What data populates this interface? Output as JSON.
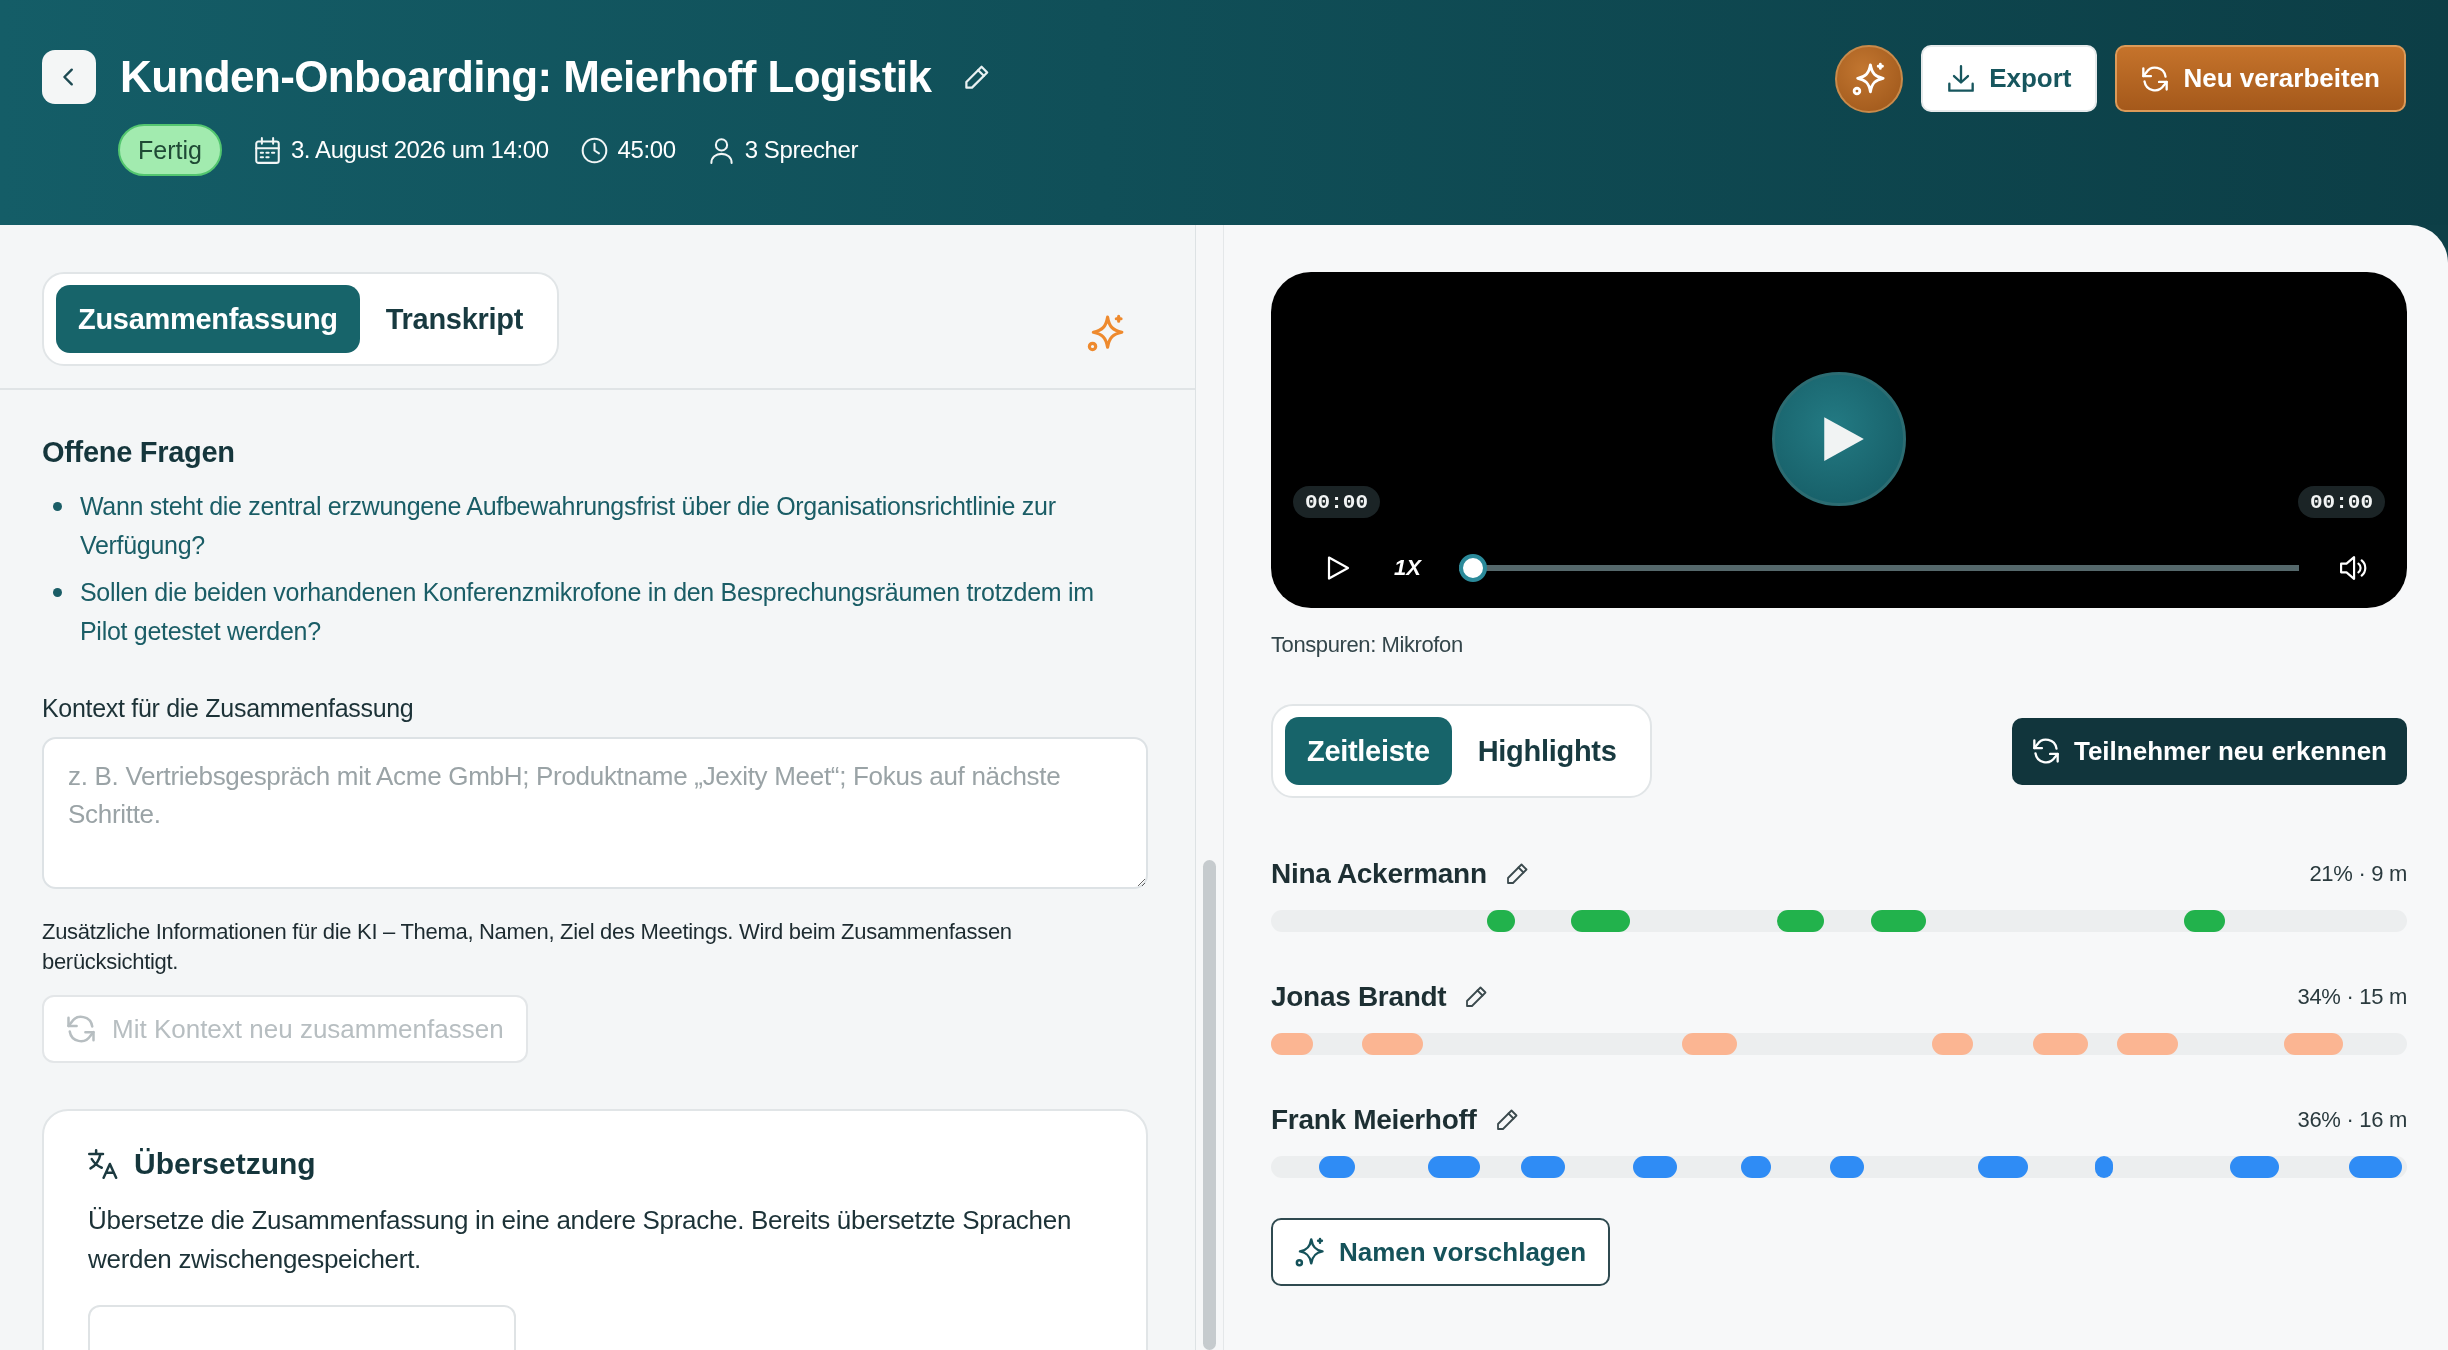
{
  "header": {
    "title": "Kunden-Onboarding: Meierhoff Logistik",
    "status": "Fertig",
    "date": "3. August 2026 um 14:00",
    "duration": "45:00",
    "speakers": "3 Sprecher",
    "actions": [
      {
        "kind": "assistant"
      },
      {
        "kind": "export",
        "label": "Export"
      },
      {
        "kind": "reprocess",
        "label": "Neu verarbeiten"
      }
    ]
  },
  "summary_panel": {
    "tabs": [
      {
        "label": "Zusammenfassung",
        "selected": true
      },
      {
        "label": "Transkript",
        "selected": false
      }
    ],
    "open_questions": {
      "heading": "Offene Fragen",
      "items": [
        "Wann steht die zentral erzwungene Aufbewahrungsfrist über die Organisationsrichtlinie zur Verfügung?",
        "Sollen die beiden vorhandenen Konferenzmikrofone in den Besprechungsräumen trotzdem im Pilot getestet werden?"
      ]
    },
    "context": {
      "label": "Kontext für die Zusammenfassung",
      "placeholder": "z. B. Vertriebsgespräch mit Acme GmbH; Produktname „Jexity Meet“; Fokus auf nächste Schritte.",
      "help": "Zusätzliche Informationen für die KI – Thema, Namen, Ziel des Meetings. Wird beim Zusammenfassen berücksichtigt.",
      "button": {
        "label": "Mit Kontext neu zusammenfassen",
        "disabled": true
      }
    },
    "translation": {
      "heading": "Übersetzung",
      "description": "Übersetze die Zusammenfassung in eine andere Sprache. Bereits übersetzte Sprachen werden zwischengespeichert."
    }
  },
  "player": {
    "current_time": "00:00",
    "total_time": "00:00",
    "speed": "1X",
    "progress": {
      "level": 0
    },
    "track_info": "Tonspuren: Mikrofon"
  },
  "timeline_panel": {
    "tabs": [
      {
        "label": "Zeitleiste",
        "selected": true
      },
      {
        "label": "Highlights",
        "selected": false
      }
    ],
    "redetect_button": "Teilnehmer neu erkennen",
    "speakers": [
      {
        "name": "Nina Ackermann",
        "stats": "21% · 9 m",
        "color": "#22b24c"
      },
      {
        "name": "Jonas Brandt",
        "stats": "34% · 15 m",
        "color": "#fbb592"
      },
      {
        "name": "Frank Meierhoff",
        "stats": "36% · 16 m",
        "color": "#2f8cf5"
      }
    ],
    "suggest_button": "Namen vorschlagen"
  }
}
